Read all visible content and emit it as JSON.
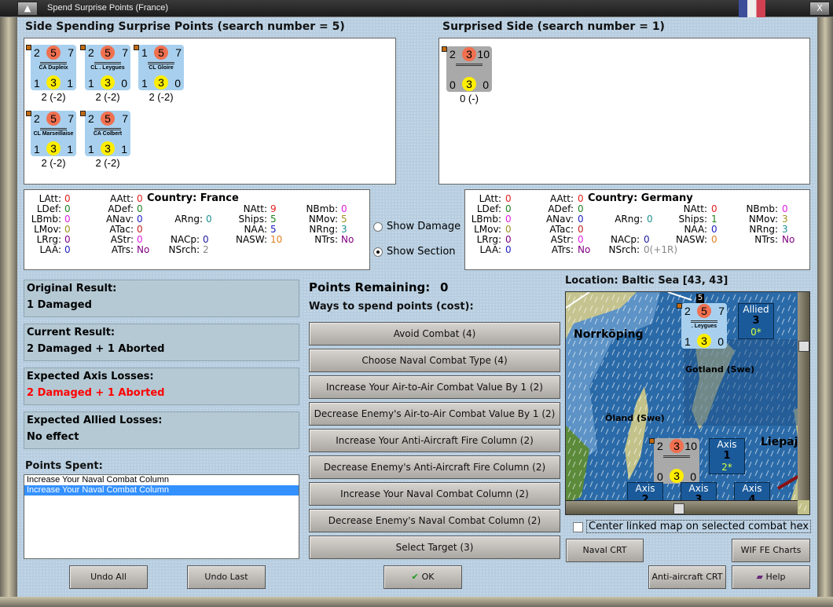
{
  "window": {
    "title": "Spend Surprise Points (France)",
    "flag": "france"
  },
  "spending": {
    "header": "Side Spending Surprise Points (search number = 5)",
    "units": [
      {
        "tl": "2",
        "top": "5",
        "tr": "7",
        "name": "CA Dupleix",
        "bl": "1",
        "bot": "3",
        "br": "1",
        "sub": "2 (-2)"
      },
      {
        "tl": "2",
        "top": "5",
        "tr": "7",
        "name": "CL . Leygues",
        "bl": "1",
        "bot": "3",
        "br": "0",
        "sub": "2 (-2)"
      },
      {
        "tl": "1",
        "top": "5",
        "tr": "7",
        "name": "CL Gloire",
        "bl": "1",
        "bot": "3",
        "br": "0",
        "sub": "2 (-2)"
      },
      {
        "tl": "2",
        "top": "5",
        "tr": "7",
        "name": "CL Marseillaise",
        "bl": "1",
        "bot": "3",
        "br": "1",
        "sub": "2 (-2)"
      },
      {
        "tl": "2",
        "top": "5",
        "tr": "7",
        "name": "CA Colbert",
        "bl": "1",
        "bot": "3",
        "br": "1",
        "sub": "2 (-2)"
      }
    ]
  },
  "surprised": {
    "header": "Surprised Side (search number = 1)",
    "units": [
      {
        "tl": "2",
        "top": "3",
        "tr": "10",
        "bl": "0",
        "bot": "3",
        "br": "0",
        "sub": "0 (-)"
      }
    ]
  },
  "stats_left": {
    "country": "Country: France",
    "LAtt": "0",
    "LDef": "0",
    "LBmb": "0",
    "LMov": "0",
    "LRrg": "0",
    "LAA": "0",
    "AAtt": "0",
    "ADef": "0",
    "ANav": "0",
    "ATac": "0",
    "AStr": "0",
    "ATrs": "No",
    "ARng": "0",
    "NACp": "0",
    "NSrch": "2",
    "NAtt": "9",
    "Ships": "5",
    "NAA": "5",
    "NASW": "10",
    "NBmb": "0",
    "NMov": "5",
    "NRng": "3",
    "NTrs": "No"
  },
  "stats_right": {
    "country": "Country: Germany",
    "LAtt": "0",
    "LDef": "0",
    "LBmb": "0",
    "LMov": "0",
    "LRrg": "0",
    "LAA": "0",
    "AAtt": "0",
    "ADef": "0",
    "ANav": "0",
    "ATac": "0",
    "AStr": "0",
    "ATrs": "No",
    "ARng": "0",
    "NACp": "0",
    "NSrch": "0(+1R)",
    "NAtt": "0",
    "Ships": "1",
    "NAA": "0",
    "NASW": "0",
    "NBmb": "0",
    "NMov": "3",
    "NRng": "3",
    "NTrs": "No"
  },
  "options": {
    "show_damage": "Show Damage",
    "show_section": "Show Section",
    "selected": "show_section"
  },
  "results": [
    {
      "title": "Original Result:",
      "value": "1 Damaged"
    },
    {
      "title": "Current Result:",
      "value": "2 Damaged + 1 Aborted"
    },
    {
      "title": "Expected Axis Losses:",
      "value": "2 Damaged + 1 Aborted",
      "color": "#ff0000"
    },
    {
      "title": "Expected Allied Losses:",
      "value": "No effect"
    }
  ],
  "points_spent": {
    "label": "Points Spent:",
    "items": [
      "Increase Your Naval Combat Column",
      "Increase Your Naval Combat Column"
    ],
    "selected_index": 1
  },
  "points_remaining": {
    "label": "Points Remaining:",
    "value": "0"
  },
  "ways": {
    "label": "Ways to spend points (cost):",
    "buttons": [
      "Avoid Combat (4)",
      "Choose Naval Combat Type (4)",
      "Increase Your Air-to-Air Combat Value By 1 (2)",
      "Decrease Enemy's Air-to-Air Combat Value By 1 (2)",
      "Increase Your Anti-Aircraft Fire Column (2)",
      "Decrease Enemy's Anti-Aircraft Fire Column (2)",
      "Increase Your Naval Combat Column (2)",
      "Decrease Enemy's Naval Combat Column (2)",
      "Select Target (3)"
    ]
  },
  "map": {
    "location": "Location: Baltic Sea [43, 43]",
    "labels": {
      "norrkoping": "Norrköping",
      "gotland": "Gotland (Swe)",
      "oland": "Öland (Swe)",
      "liepaja": "Liepaj"
    },
    "boxes": [
      {
        "side": "Allied",
        "n": "3",
        "s": "0*"
      },
      {
        "side": "Axis",
        "n": "1",
        "s": "2*"
      },
      {
        "side": "Axis",
        "n": "2"
      },
      {
        "side": "Axis",
        "n": "3"
      },
      {
        "side": "Axis",
        "n": "4"
      }
    ],
    "stack_count": "5",
    "unit_allied": {
      "tl": "2",
      "top": "5",
      "tr": "7",
      "name": ". Leygues",
      "bl": "1",
      "bot": "3",
      "br": "0"
    },
    "unit_axis": {
      "tl": "2",
      "top": "3",
      "tr": "10",
      "bl": "0",
      "bot": "3",
      "br": "0"
    },
    "center_checkbox": "Center linked map on selected combat hex",
    "center_checked": false
  },
  "buttons": {
    "naval_crt": "Naval CRT",
    "wif_charts": "WIF FE Charts",
    "aa_crt": "Anti-aircraft CRT",
    "help": "Help",
    "undo_all": "Undo All",
    "undo_last": "Undo Last",
    "ok": "OK"
  }
}
